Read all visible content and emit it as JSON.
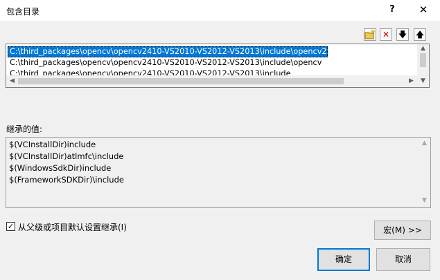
{
  "window": {
    "title": "包含目录",
    "help_glyph": "?",
    "close_glyph": "✕"
  },
  "toolbar": {
    "new_line_icon": "new-folder-icon",
    "delete_glyph": "✕",
    "move_down_glyph": "🡇",
    "move_up_glyph": "🡅"
  },
  "dir_list": {
    "items": [
      "C:\\third_packages\\opencv\\opencv2410-VS2010-VS2012-VS2013\\include\\opencv2",
      "C:\\third_packages\\opencv\\opencv2410-VS2010-VS2012-VS2013\\include\\opencv",
      "C:\\third_packages\\opencv\\opencv2410-VS2010-VS2012-VS2013\\include"
    ],
    "selected_index": 0
  },
  "inherited": {
    "label": "继承的值:",
    "items": [
      "$(VCInstallDir)include",
      "$(VCInstallDir)atlmfc\\include",
      "$(WindowsSdkDir)include",
      "$(FrameworkSDKDir)\\include"
    ]
  },
  "inherit_checkbox": {
    "label": "从父级或项目默认设置继承(I)",
    "checked": true
  },
  "buttons": {
    "macros": "宏(M) >>",
    "ok": "确定",
    "cancel": "取消"
  },
  "colors": {
    "selection": "#0078d7",
    "focus_border": "#0078d7"
  }
}
